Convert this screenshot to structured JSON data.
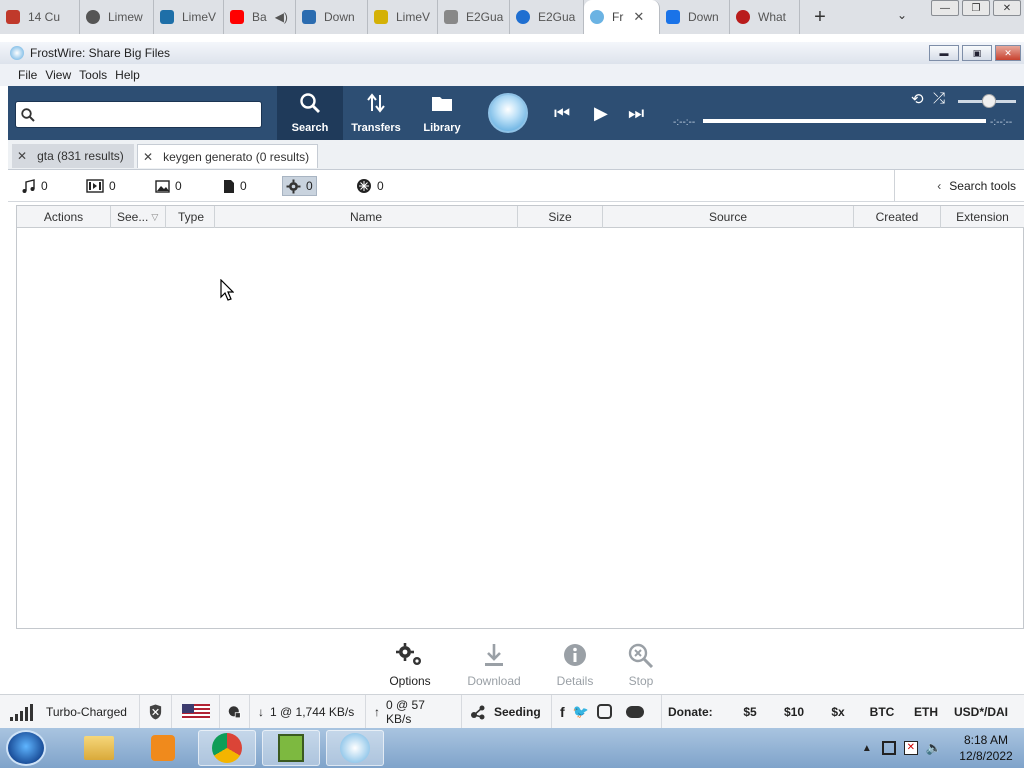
{
  "browser_tabs": [
    {
      "label": "14 Cu",
      "color": "#c0392b"
    },
    {
      "label": "Limew",
      "color": "#555555"
    },
    {
      "label": "LimeV",
      "color": "#1e6fa8"
    },
    {
      "label": "Ba",
      "color": "#ff0000"
    },
    {
      "label": "Down",
      "color": "#2b6cb0"
    },
    {
      "label": "LimeV",
      "color": "#d4b106"
    },
    {
      "label": "E2Gua",
      "color": "#888888"
    },
    {
      "label": "E2Gua",
      "color": "#1f6fd1"
    },
    {
      "label": "Fr",
      "color": "#6bb3e3"
    },
    {
      "label": "Down",
      "color": "#1a73e8"
    },
    {
      "label": "What",
      "color": "#b91c1c"
    }
  ],
  "window": {
    "title": "FrostWire: Share Big Files"
  },
  "menu": [
    "File",
    "View",
    "Tools",
    "Help"
  ],
  "toolbar": {
    "search_placeholder": "",
    "search_label": "Search",
    "transfers_label": "Transfers",
    "library_label": "Library",
    "time_left": "-:--:--",
    "time_right": "-:--:--"
  },
  "result_tabs": [
    {
      "label": "gta (831 results)"
    },
    {
      "label": "keygen generato (0 results)"
    }
  ],
  "filters": {
    "audio": "0",
    "video": "0",
    "images": "0",
    "documents": "0",
    "programs": "0",
    "torrents": "0",
    "search_tools": "Search tools"
  },
  "columns": [
    "Actions",
    "See...",
    "Type",
    "Name",
    "Size",
    "Source",
    "Created",
    "Extension"
  ],
  "actions": {
    "options": "Options",
    "download": "Download",
    "details": "Details",
    "stop": "Stop"
  },
  "status": {
    "connection": "Turbo-Charged",
    "downloads": "1 @ 1,744 KB/s",
    "uploads": "0 @ 57 KB/s",
    "seeding": "Seeding",
    "donate": "Donate:",
    "donate_options": [
      "$5",
      "$10",
      "$x",
      "BTC",
      "ETH",
      "USD*/DAI"
    ]
  },
  "clock": {
    "time": "8:18 AM",
    "date": "12/8/2022"
  }
}
